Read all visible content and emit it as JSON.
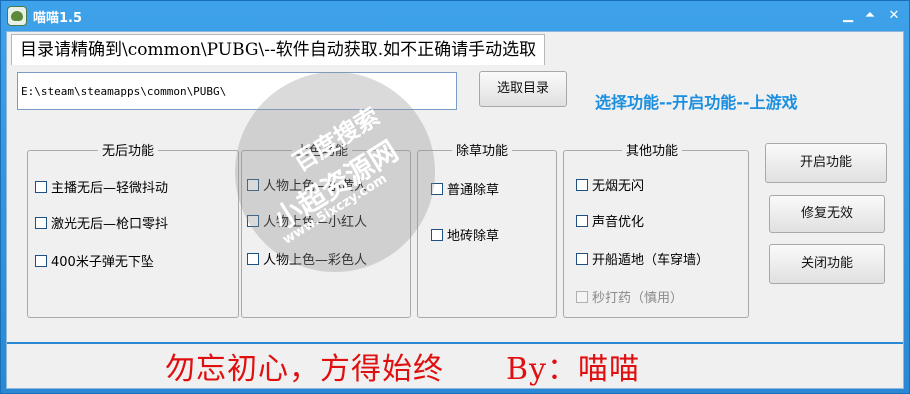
{
  "window": {
    "title": "喵喵1.5"
  },
  "dir_tab": "目录请精确到\\common\\PUBG\\--软件自动获取.如不正确请手动选取",
  "path_value": "E:\\steam\\steamapps\\common\\PUBG\\",
  "select_dir_button": "选取目录",
  "hint": "选择功能--开启功能--上游戏",
  "groups": {
    "recoil": {
      "title": "无后功能",
      "items": [
        "主播无后—轻微抖动",
        "激光无后—枪口零抖",
        "400米子弹无下坠"
      ]
    },
    "color": {
      "title": "上色功能",
      "items": [
        "人物上色—小黄人",
        "人物上色—小红人",
        "人物上色—彩色人"
      ]
    },
    "grass": {
      "title": "除草功能",
      "items": [
        "普通除草",
        "地砖除草"
      ]
    },
    "other": {
      "title": "其他功能",
      "items": [
        "无烟无闪",
        "声音优化",
        "开船遁地（车穿墙）",
        "秒打药（慎用）"
      ]
    }
  },
  "buttons": {
    "enable": "开启功能",
    "repair": "修复无效",
    "disable": "关闭功能"
  },
  "slogan": "勿忘初心，方得始终　　By：喵喵",
  "watermark": {
    "line1": "百度搜索",
    "line2": "小超资源网",
    "url": "www.5ixczy.com"
  },
  "colors": {
    "title_bar": "#2f8fd8",
    "hint": "#1a8fe0",
    "slogan": "#e01010"
  }
}
